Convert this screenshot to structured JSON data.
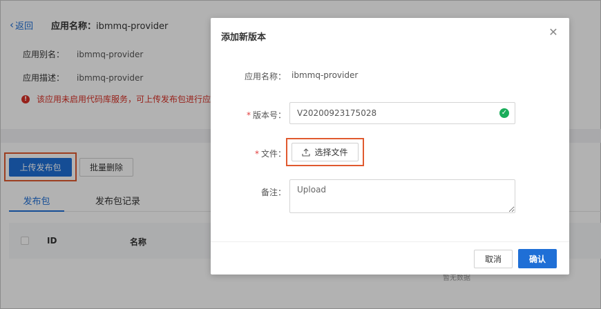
{
  "header": {
    "back_label": "返回",
    "app_name_label": "应用名称：",
    "app_name_value": "ibmmq-provider"
  },
  "info": {
    "alias_label": "应用别名：",
    "alias_value": "ibmmq-provider",
    "desc_label": "应用描述：",
    "desc_value": "ibmmq-provider",
    "warning": "该应用未启用代码库服务，可上传发布包进行应"
  },
  "toolbar": {
    "upload_label": "上传发布包",
    "batch_delete_label": "批量删除"
  },
  "tabs": [
    {
      "label": "发布包"
    },
    {
      "label": "发布包记录"
    }
  ],
  "table": {
    "columns": [
      "ID",
      "名称"
    ],
    "empty_text": "暂无数据"
  },
  "modal": {
    "title": "添加新版本",
    "app_name_label": "应用名称：",
    "app_name_value": "ibmmq-provider",
    "version_label": "版本号：",
    "version_value": "V20200923175028",
    "file_label": "文件：",
    "file_button_label": "选择文件",
    "remark_label": "备注：",
    "remark_placeholder": "Upload",
    "cancel_label": "取消",
    "confirm_label": "确认"
  },
  "colors": {
    "primary": "#1f6fd6",
    "error": "#d93026",
    "success": "#1aad5a",
    "highlight": "#e0592e"
  }
}
